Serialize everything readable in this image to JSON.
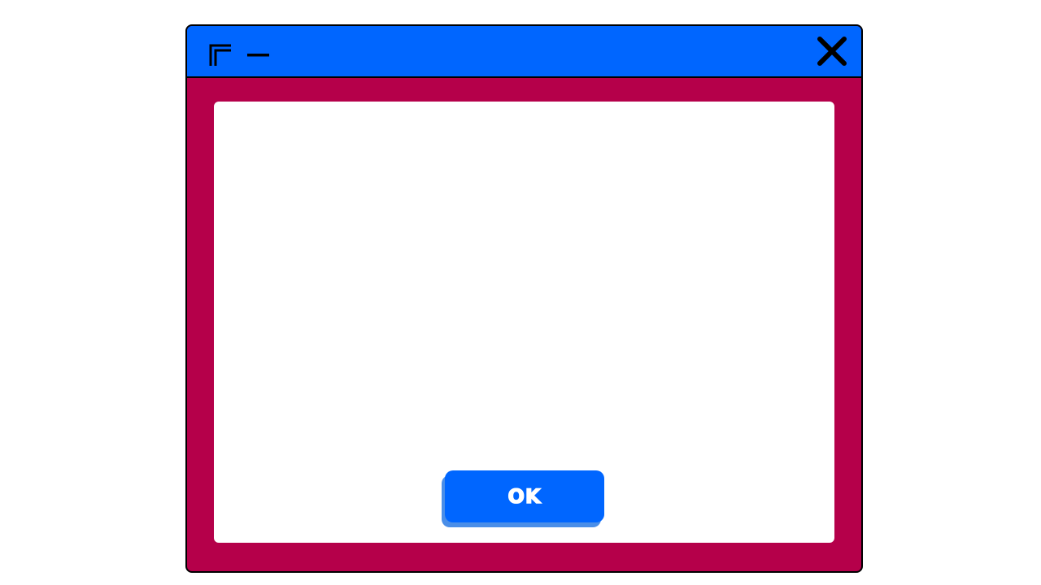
{
  "window": {
    "colors": {
      "titlebar": "#0066ff",
      "frame": "#b5004a",
      "content": "#ffffff",
      "outline": "#000000"
    },
    "titlebar": {
      "icons": [
        "maximize-icon",
        "minimize-icon",
        "close-icon"
      ]
    },
    "dialog": {
      "ok_label": "OK",
      "button_color": "#0066ff",
      "button_shadow_color": "#4a8ee8"
    }
  }
}
